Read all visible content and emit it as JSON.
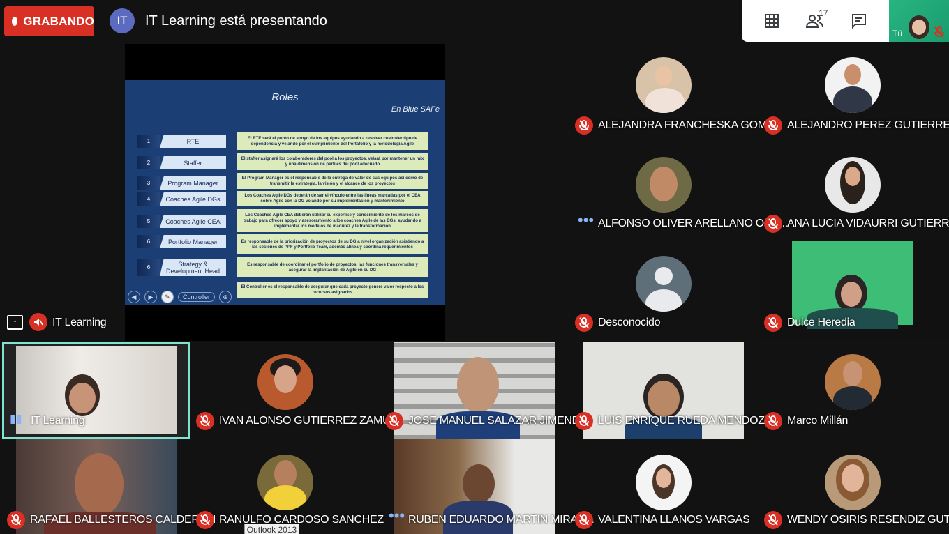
{
  "recording": {
    "label": "GRABANDO",
    "color": "#d93025"
  },
  "presenter": {
    "avatar_initials": "IT",
    "text": "IT Learning está presentando"
  },
  "top_controls": {
    "participants_count": "17",
    "self_label": "Tú"
  },
  "slide": {
    "title": "Roles",
    "subtitle": "En Blue SAFe",
    "rows": [
      {
        "num": "1",
        "role": "RTE",
        "desc": "El RTE será el punto de apoyo de los equipos ayudando a resolver cualquier tipo de dependencia y velando por el cumplimiento del Portafolio y la metodología Agile"
      },
      {
        "num": "2",
        "role": "Staffer",
        "desc": "El staffer asignará los colaboradores del pool a los proyectos, velará por mantener un mix y una dimensión de perfiles del pool adecuado"
      },
      {
        "num": "3",
        "role": "Program Manager",
        "desc": "El Program Manager es el responsable de la entrega de valor de sus equipos así como de transmitir la estrategia, la visión y el alcance de los proyectos"
      },
      {
        "num": "4",
        "role": "Coaches Agile DGs",
        "desc": "Los Coaches Agile DGs deberán de ser el vínculo entre las líneas marcadas por el CEA sobre Agile con la DG velando por su implementación y mantenimiento"
      },
      {
        "num": "5",
        "role": "Coaches Agile CEA",
        "desc": "Los Coaches Agile CEA deberán utilizar su expertise y conocimiento de los marcos de trabajo para ofrecer apoyo y asesoramiento a los coaches Agile de las DGs, ayudando a implementar los modelos de madurez y la transformación"
      },
      {
        "num": "6",
        "role": "Portfolio Manager",
        "desc": "Es responsable de la priorización de proyectos de su DG a nivel organización asistiendo a las sesiones de PPF y Portfolio Team, además alinea y coordina requerimientos"
      },
      {
        "num": "6",
        "role": "Strategy & Development Head",
        "desc": "Es responsable de coordinar el portfolio de proyectos, las funciones transversales y asegurar la implantación de Agile en su DG"
      },
      {
        "num": "",
        "role": "Controller",
        "desc": "El Controller es el responsable de asegurar que cada proyecto genere valor respecto a los recursos asignados"
      }
    ]
  },
  "presenter_tile_name": "IT Learning",
  "participants": [
    {
      "name": "ALEJANDRA FRANCHESKA GOME...",
      "status": "muted"
    },
    {
      "name": "ALEJANDRO PEREZ GUTIERREZ",
      "status": "muted"
    },
    {
      "name": "ALFONSO OLIVER ARELLANO OCE...",
      "status": "speaking"
    },
    {
      "name": "ANA LUCIA VIDAURRI GUTIERREZ",
      "status": "muted"
    },
    {
      "name": "Desconocido",
      "status": "muted"
    },
    {
      "name": "Dulce Heredia",
      "status": "muted"
    },
    {
      "name": "IT Learning",
      "status": "audio"
    },
    {
      "name": "IVAN ALONSO GUTIERREZ ZAMUDIO",
      "status": "muted"
    },
    {
      "name": "JOSE MANUEL SALAZAR JIMENEZ",
      "status": "muted"
    },
    {
      "name": "LUIS ENRIQUE RUEDA MENDOZA",
      "status": "muted"
    },
    {
      "name": "Marco Millán",
      "status": "muted"
    },
    {
      "name": "RAFAEL BALLESTEROS CALDERON",
      "status": "muted"
    },
    {
      "name": "RANULFO CARDOSO SANCHEZ",
      "status": "muted"
    },
    {
      "name": "RUBEN EDUARDO MARTIN MIRAN...",
      "status": "speaking"
    },
    {
      "name": "VALENTINA LLANOS VARGAS",
      "status": "muted"
    },
    {
      "name": "WENDY OSIRIS RESENDIZ GUTIER...",
      "status": "muted"
    }
  ],
  "tooltip": "Outlook 2013",
  "colors": {
    "accent_border": "#7fe3d0",
    "mic_muted": "#d93025",
    "slide_bg": "#1b3e75"
  }
}
